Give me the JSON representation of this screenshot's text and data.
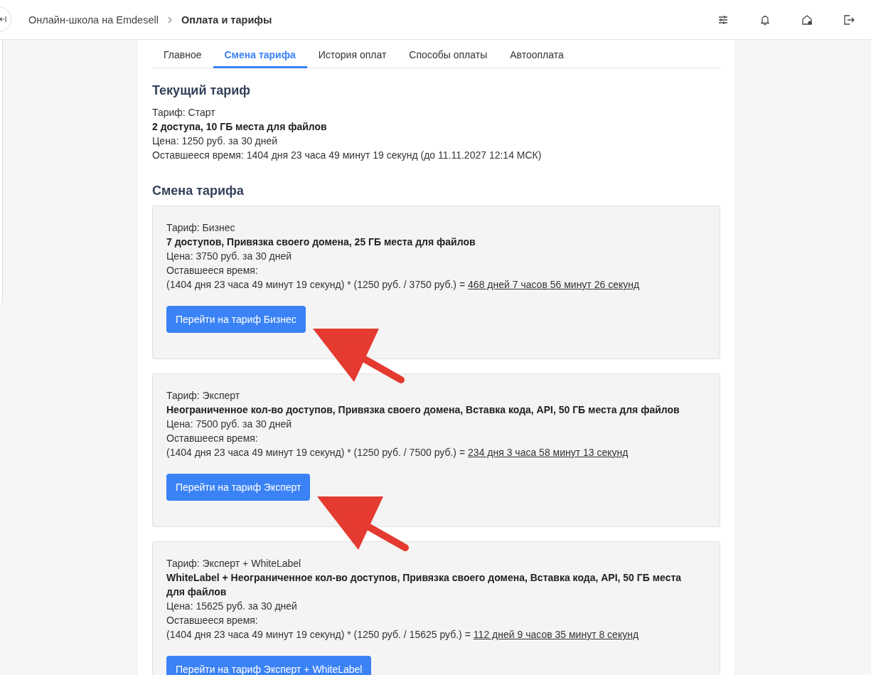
{
  "header": {
    "breadcrumbs": [
      {
        "label": "Онлайн-школа на Emdesell",
        "current": false
      },
      {
        "label": "Оплата и тарифы",
        "current": true
      }
    ]
  },
  "tabs": [
    {
      "label": "Главное",
      "selected": false
    },
    {
      "label": "Смена тарифа",
      "selected": true
    },
    {
      "label": "История оплат",
      "selected": false
    },
    {
      "label": "Способы оплаты",
      "selected": false
    },
    {
      "label": "Автооплата",
      "selected": false
    }
  ],
  "current_plan": {
    "title": "Текущий тариф",
    "plan": "Тариф: Старт",
    "features": "2 доступа, 10 ГБ места для файлов",
    "price": "Цена: 1250 руб. за 30 дней",
    "remaining": "Оставшееся время: 1404 дня 23 часа 49 минут 19 секунд (до 11.11.2027 12:14 МСК)"
  },
  "change_plan": {
    "title": "Смена тарифа",
    "plans": [
      {
        "plan": "Тариф: Бизнес",
        "features": "7 доступов, Привязка своего домена, 25 ГБ места для файлов",
        "price": "Цена: 3750 руб. за 30 дней",
        "remaining_label": "Оставшееся время:",
        "formula": "(1404 дня 23 часа 49 минут 19 секунд) * (1250 руб. / 3750 руб.) =",
        "result": "468 дней 7 часов 56 минут 26 секунд",
        "button": "Перейти на тариф Бизнес"
      },
      {
        "plan": "Тариф: Эксперт",
        "features": "Неограниченное кол-во доступов, Привязка своего домена, Вставка кода, API, 50 ГБ места для файлов",
        "price": "Цена: 7500 руб. за 30 дней",
        "remaining_label": "Оставшееся время:",
        "formula": "(1404 дня 23 часа 49 минут 19 секунд) * (1250 руб. / 7500 руб.) =",
        "result": "234 дня 3 часа 58 минут 13 секунд",
        "button": "Перейти на тариф Эксперт"
      },
      {
        "plan": "Тариф: Эксперт + WhiteLabel",
        "features": "WhiteLabel + Неограниченное кол-во доступов, Привязка своего домена, Вставка кода, API, 50 ГБ места для файлов",
        "price": "Цена: 15625 руб. за 30 дней",
        "remaining_label": "Оставшееся время:",
        "formula": "(1404 дня 23 часа 49 минут 19 секунд) * (1250 руб. / 15625 руб.) =",
        "result": "112 дней 9 часов 35 минут 8 секунд",
        "button": "Перейти на тариф Эксперт + WhiteLabel"
      }
    ]
  },
  "annotations": [
    {
      "kind": "arrow"
    },
    {
      "kind": "arrow"
    }
  ]
}
